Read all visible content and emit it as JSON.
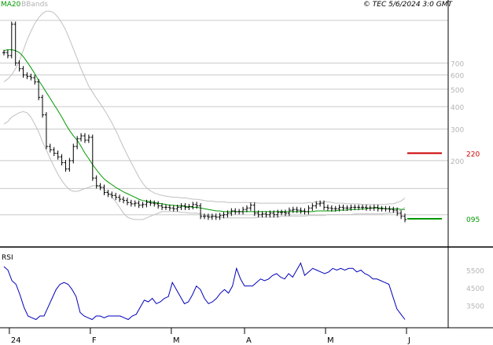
{
  "header": {
    "legend_ma": "MA20",
    "legend_bb": "BBands",
    "copyright_mark": "©",
    "copyright": "TEC 5/6/2024 3:0 GMT"
  },
  "colors": {
    "price": "#000000",
    "ma20": "#009900",
    "bbands": "#c0c0c0",
    "rsi": "#0000bb",
    "resistance": "#cc0000",
    "support": "#009900",
    "grid": "#c8c8c8",
    "axis_text": "#b4b4b4"
  },
  "chart_data": [
    {
      "type": "ohlc",
      "name": "price",
      "y_scale": "log",
      "ylim": [
        0.85,
        13.5
      ],
      "yticks": [
        2,
        3,
        4,
        5,
        6,
        7
      ],
      "ytick_labels": [
        "200",
        "300",
        "400",
        "500",
        "600",
        "700"
      ],
      "levels": [
        {
          "label": "220",
          "value": 2.2,
          "color": "#cc0000"
        },
        {
          "label": "095",
          "value": 0.95,
          "color": "#009900"
        }
      ],
      "xticks": [
        {
          "label": "24",
          "index": 1
        },
        {
          "label": "F",
          "index": 22
        },
        {
          "label": "M",
          "index": 43
        },
        {
          "label": "A",
          "index": 62
        },
        {
          "label": "M",
          "index": 83
        },
        {
          "label": "J",
          "index": 104
        }
      ],
      "prices": [
        8.0,
        7.7,
        11.5,
        7.0,
        6.5,
        6.0,
        5.9,
        5.8,
        5.5,
        4.5,
        3.6,
        2.4,
        2.3,
        2.2,
        2.1,
        1.95,
        1.8,
        2.0,
        2.4,
        2.65,
        2.75,
        2.6,
        2.7,
        1.6,
        1.45,
        1.42,
        1.33,
        1.3,
        1.28,
        1.25,
        1.22,
        1.2,
        1.17,
        1.15,
        1.16,
        1.13,
        1.14,
        1.17,
        1.16,
        1.15,
        1.12,
        1.1,
        1.1,
        1.09,
        1.08,
        1.1,
        1.12,
        1.1,
        1.11,
        1.14,
        1.12,
        0.98,
        0.98,
        0.97,
        0.98,
        0.97,
        0.99,
        1.0,
        1.02,
        1.05,
        1.04,
        1.04,
        1.07,
        1.09,
        1.13,
        1.02,
        1.0,
        1.01,
        1.0,
        1.02,
        1.0,
        1.03,
        1.03,
        1.02,
        1.06,
        1.07,
        1.06,
        1.05,
        1.04,
        1.09,
        1.12,
        1.15,
        1.16,
        1.1,
        1.09,
        1.08,
        1.08,
        1.1,
        1.09,
        1.09,
        1.1,
        1.1,
        1.1,
        1.1,
        1.09,
        1.09,
        1.1,
        1.08,
        1.08,
        1.08,
        1.07,
        1.06,
        1.02,
        0.98,
        0.94
      ],
      "series": [
        {
          "name": "MA20",
          "values": [
            8.2,
            8.3,
            8.3,
            8.2,
            8.0,
            7.6,
            7.1,
            6.6,
            6.1,
            5.6,
            5.2,
            4.8,
            4.45,
            4.1,
            3.8,
            3.5,
            3.2,
            2.95,
            2.75,
            2.6,
            2.4,
            2.2,
            2.05,
            1.9,
            1.78,
            1.67,
            1.58,
            1.52,
            1.47,
            1.42,
            1.38,
            1.34,
            1.31,
            1.28,
            1.25,
            1.22,
            1.2,
            1.19,
            1.18,
            1.17,
            1.16,
            1.15,
            1.14,
            1.13,
            1.13,
            1.12,
            1.12,
            1.11,
            1.11,
            1.1,
            1.1,
            1.09,
            1.08,
            1.07,
            1.06,
            1.05,
            1.05,
            1.04,
            1.04,
            1.04,
            1.04,
            1.04,
            1.04,
            1.04,
            1.04,
            1.04,
            1.04,
            1.04,
            1.04,
            1.04,
            1.04,
            1.04,
            1.04,
            1.04,
            1.04,
            1.04,
            1.04,
            1.04,
            1.04,
            1.04,
            1.04,
            1.05,
            1.05,
            1.05,
            1.05,
            1.05,
            1.05,
            1.06,
            1.06,
            1.06,
            1.07,
            1.07,
            1.07,
            1.08,
            1.08,
            1.09,
            1.09,
            1.09,
            1.09,
            1.08,
            1.08,
            1.08,
            1.08,
            1.07,
            1.07
          ]
        },
        {
          "name": "BBands",
          "values": [
            5.5,
            5.7,
            6.0,
            6.5,
            7.2,
            8.2,
            9.4,
            10.5,
            11.6,
            12.5,
            13.2,
            13.6,
            13.6,
            13.3,
            12.6,
            11.7,
            10.7,
            9.5,
            8.4,
            7.4,
            6.5,
            5.8,
            5.2,
            4.8,
            4.45,
            4.15,
            3.85,
            3.55,
            3.25,
            2.95,
            2.65,
            2.38,
            2.15,
            1.95,
            1.78,
            1.62,
            1.5,
            1.41,
            1.36,
            1.32,
            1.3,
            1.28,
            1.27,
            1.26,
            1.25,
            1.25,
            1.24,
            1.24,
            1.23,
            1.22,
            1.22,
            1.21,
            1.2,
            1.19,
            1.19,
            1.18,
            1.18,
            1.18,
            1.17,
            1.17,
            1.17,
            1.17,
            1.17,
            1.17,
            1.17,
            1.17,
            1.16,
            1.16,
            1.16,
            1.16,
            1.16,
            1.16,
            1.16,
            1.16,
            1.16,
            1.16,
            1.16,
            1.16,
            1.16,
            1.17,
            1.17,
            1.18,
            1.18,
            1.18,
            1.18,
            1.17,
            1.16,
            1.16,
            1.16,
            1.15,
            1.15,
            1.15,
            1.15,
            1.14,
            1.14,
            1.14,
            1.14,
            1.14,
            1.14,
            1.14,
            1.15,
            1.15,
            1.17,
            1.19,
            1.24
          ]
        },
        {
          "name": "BBands",
          "values": [
            3.2,
            3.3,
            3.5,
            3.6,
            3.7,
            3.75,
            3.7,
            3.5,
            3.2,
            2.9,
            2.55,
            2.3,
            2.05,
            1.85,
            1.68,
            1.55,
            1.45,
            1.38,
            1.35,
            1.35,
            1.37,
            1.4,
            1.42,
            1.45,
            1.45,
            1.42,
            1.38,
            1.33,
            1.26,
            1.18,
            1.1,
            1.02,
            0.97,
            0.95,
            0.94,
            0.94,
            0.94,
            0.96,
            0.98,
            1.0,
            1.02,
            1.04,
            1.04,
            1.04,
            1.04,
            1.04,
            1.03,
            1.03,
            1.02,
            1.02,
            1.02,
            1.01,
            1.0,
            0.99,
            0.98,
            0.97,
            0.97,
            0.96,
            0.96,
            0.96,
            0.96,
            0.96,
            0.96,
            0.96,
            0.96,
            0.96,
            0.97,
            0.97,
            0.97,
            0.97,
            0.97,
            0.97,
            0.98,
            0.98,
            0.98,
            0.98,
            0.98,
            0.98,
            0.98,
            0.99,
            0.99,
            0.99,
            0.99,
            0.99,
            1.0,
            1.0,
            1.0,
            1.0,
            1.0,
            1.0,
            1.0,
            1.01,
            1.01,
            1.01,
            1.01,
            1.01,
            1.01,
            1.01,
            1.01,
            1.02,
            1.02,
            1.03,
            1.04,
            1.06,
            1.1
          ]
        }
      ]
    },
    {
      "type": "line",
      "title": "RSI",
      "ylim": [
        25,
        65
      ],
      "yticks": [
        35,
        45,
        55
      ],
      "ytick_labels": [
        "3500",
        "4500",
        "5500"
      ],
      "values": [
        57,
        55,
        49,
        47,
        41,
        34,
        29,
        28,
        27,
        29,
        29,
        34,
        39,
        44,
        47,
        48,
        47,
        44,
        40,
        31,
        29,
        28,
        27,
        29,
        29,
        28,
        29,
        29,
        29,
        29,
        28,
        27,
        29,
        30,
        34,
        38,
        37,
        39,
        36,
        37,
        39,
        40,
        48,
        44,
        40,
        36,
        37,
        41,
        46,
        44,
        39,
        36,
        37,
        39,
        42,
        44,
        42,
        46,
        56,
        50,
        46,
        46,
        46,
        48,
        50,
        49,
        50,
        52,
        53,
        51,
        50,
        53,
        51,
        55,
        59,
        52,
        54,
        56,
        55,
        54,
        53,
        54,
        56,
        55,
        56,
        55,
        56,
        56,
        54,
        55,
        53,
        52,
        50,
        50,
        49,
        48,
        47,
        40,
        33,
        30,
        27
      ]
    }
  ]
}
